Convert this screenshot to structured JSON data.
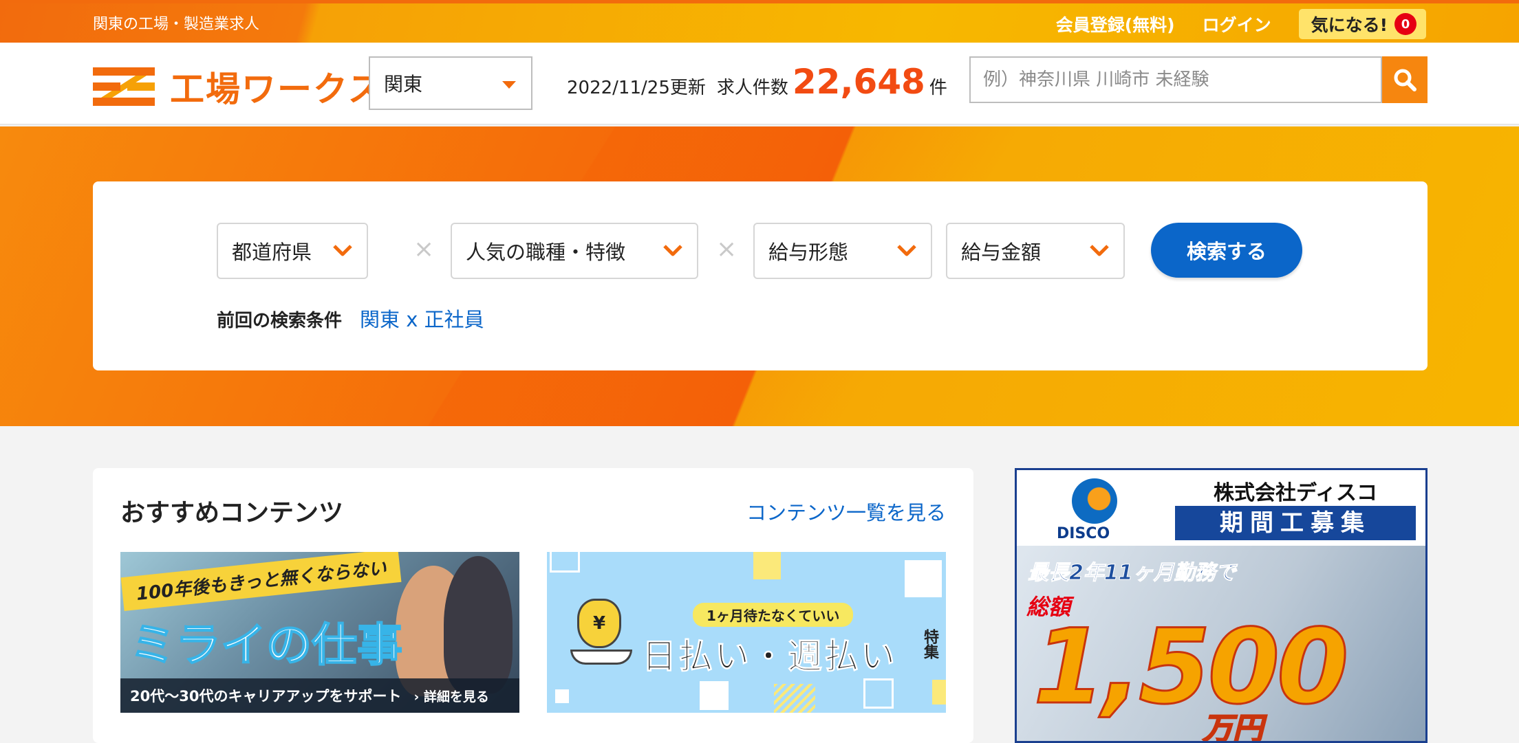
{
  "topbar": {
    "tagline": "関東の工場・製造業求人",
    "register": "会員登録(無料)",
    "login": "ログイン",
    "favorites_label": "気になる!",
    "favorites_count": "0"
  },
  "header": {
    "logo_text": "工場ワークス",
    "region": "関東",
    "updated": "2022/11/25更新",
    "jobs_label": "求人件数",
    "jobs_count": "22,648",
    "jobs_unit": "件",
    "search_placeholder": "例）神奈川県 川崎市 未経験"
  },
  "search_card": {
    "prefecture": "都道府県",
    "occupation": "人気の職種・特徴",
    "pay_type": "給与形態",
    "pay_amount": "給与金額",
    "search_button": "検索する",
    "previous_label": "前回の検索条件",
    "previous_value": "関東 x 正社員"
  },
  "recommended": {
    "title": "おすすめコンテンツ",
    "see_all": "コンテンツ一覧を見る",
    "banner1": {
      "ribbon": "100年後もきっと無くならない",
      "headline": "ミライの仕事",
      "caption": "20代〜30代のキャリアアップをサポート",
      "detail": "› 詳細を見る"
    },
    "banner2": {
      "tag": "1ヶ月待たなくていい",
      "headline": "日払い・週払い",
      "side": "特集",
      "bag_symbol": "¥"
    }
  },
  "ad": {
    "brand": "DISCO",
    "company": "株式会社ディスコ",
    "recruit": "期間工募集",
    "copy": "最長2年11ヶ月勤務で",
    "total_label": "総額",
    "amount": "1,500",
    "unit": "万円"
  },
  "colors": {
    "brand_orange": "#f26b0d",
    "accent_blue": "#0b66c9",
    "badge_red": "#e60012"
  }
}
